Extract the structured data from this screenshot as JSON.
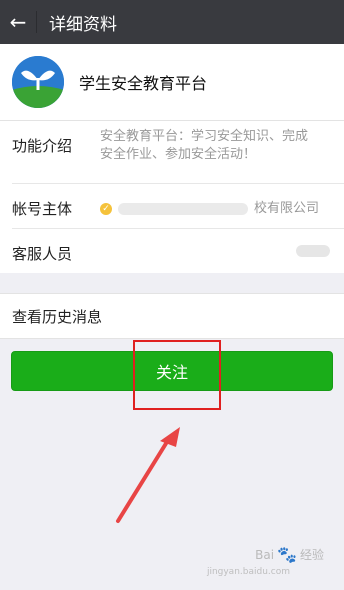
{
  "topbar": {
    "back_icon": "arrow-left-icon",
    "title": "详细资料"
  },
  "profile": {
    "name": "学生安全教育平台",
    "logo_icon": "sprout-logo"
  },
  "info": {
    "intro": {
      "label": "功能介绍",
      "line1": "安全教育平台：学习安全知识、完成",
      "line2": "安全作业、参加安全活动！"
    },
    "owner": {
      "label": "帐号主体",
      "value": "校有限公司",
      "verified_icon": "verified-icon"
    },
    "service": {
      "label": "客服人员",
      "value": ""
    }
  },
  "history": {
    "label": "查看历史消息"
  },
  "follow_button": {
    "label": "关注",
    "color": "#1aad19"
  },
  "annotation": {
    "box_color": "#e02020",
    "arrow_color": "#e84545"
  },
  "watermark": {
    "brand": "Bai",
    "brand2": "经验",
    "sub": "jingyan.baidu.com"
  }
}
